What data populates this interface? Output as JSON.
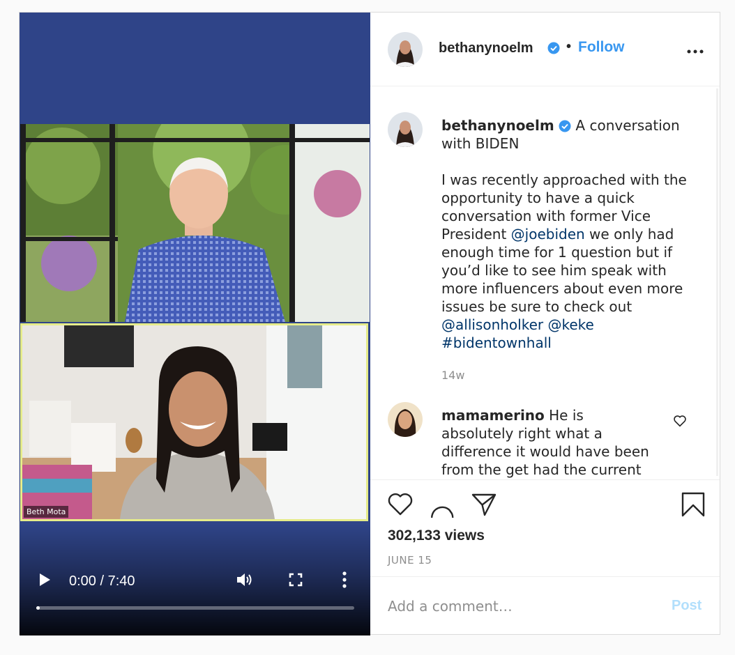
{
  "video": {
    "participant_label": "Beth Mota",
    "time": "0:00 / 7:40",
    "progress": 0.01
  },
  "header": {
    "username": "bethanynoelm",
    "dot": "•",
    "follow_label": "Follow"
  },
  "caption": {
    "username": "bethanynoelm",
    "text_intro": "A conversation with BIDEN",
    "body_1": "I was recently approached with the opportunity to have a quick conversation with former Vice President",
    "mention_1": "@joebiden",
    "body_2": "we only had enough time for 1 question but if you’d like to see him speak with more influencers about even more issues be sure to check out",
    "mention_2": "@allisonholker",
    "mention_3": "@keke",
    "hashtag": "#bidentownhall",
    "time": "14w"
  },
  "comment": {
    "username": "mamamerino",
    "text": "He is absolutely right what a difference it would have been from the get had the current president just"
  },
  "actions": {
    "views": "302,133 views",
    "date": "JUNE 15"
  },
  "add_comment": {
    "placeholder": "Add a comment…",
    "post_label": "Post"
  },
  "colors": {
    "accent": "#3897f0",
    "verified": "#3897f0",
    "link": "#003569",
    "video_bg": "#2f4488",
    "post_disabled": "#b2dffc"
  },
  "icons": [
    "play-icon",
    "volume-icon",
    "fullscreen-icon",
    "more-vertical-icon",
    "verified-icon",
    "more-horizontal-icon",
    "heart-icon",
    "comment-icon",
    "share-icon",
    "bookmark-icon"
  ]
}
